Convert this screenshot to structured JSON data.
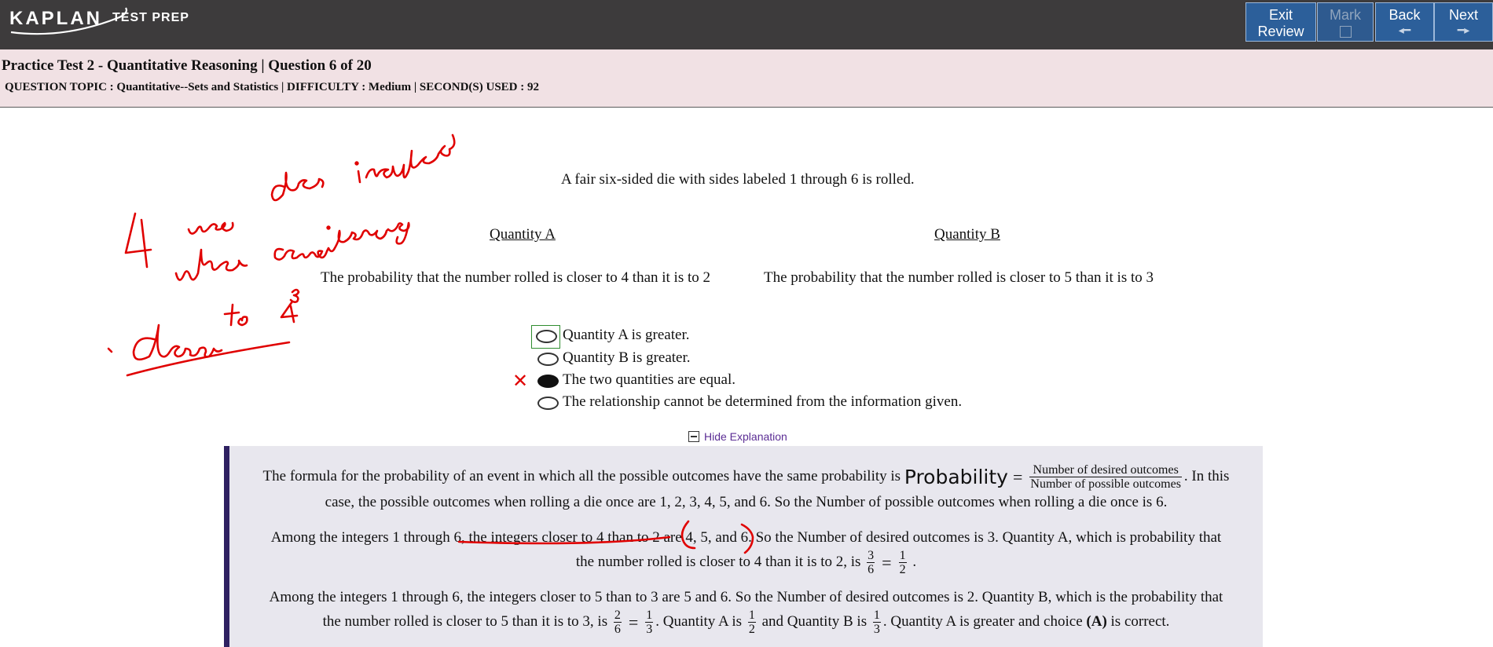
{
  "topbar": {
    "logo_brand": "KAPLAN",
    "logo_sub": "TEST PREP",
    "buttons": {
      "exit_line1": "Exit",
      "exit_line2": "Review",
      "mark": "Mark",
      "back": "Back",
      "back_arrow": "◂━",
      "next": "Next",
      "next_arrow": "━▸"
    }
  },
  "header": {
    "title": "Practice Test 2 - Quantitative Reasoning | Question 6 of 20",
    "meta": "QUESTION TOPIC : Quantitative--Sets and Statistics | DIFFICULTY : Medium | SECOND(S) USED : 92"
  },
  "question": {
    "stem": "A fair six-sided die with sides labeled 1 through 6 is rolled.",
    "quantity_a_label": "Quantity A",
    "quantity_b_label": "Quantity B",
    "quantity_a_text": "The probability that the number rolled is closer to 4 than it is to 2",
    "quantity_b_text": "The probability that the number rolled is closer to 5 than it is to 3",
    "choices": [
      {
        "label": "Quantity A is greater.",
        "selected": false
      },
      {
        "label": "Quantity B is greater.",
        "selected": false
      },
      {
        "label": "The two quantities are equal.",
        "selected": true
      },
      {
        "label": "The relationship cannot be determined from the information given.",
        "selected": false
      }
    ],
    "wrong_mark": "✕",
    "hide_explanation": "Hide Explanation"
  },
  "explanation": {
    "p1_a": "The formula for the probability of an event in which all the possible outcomes have the same probability is",
    "p1_prob": "Probability",
    "p1_eq": "=",
    "p1_num": "Number of desired outcomes",
    "p1_den": "Number of possible outcomes",
    "p1_b": ". In this",
    "p1_c": "case, the possible outcomes when rolling a die once are 1, 2, 3, 4, 5, and 6. So the Number of possible outcomes when rolling a die once is 6.",
    "p2_a": "Among the integers 1 through 6, the integers closer to 4 than to 2 are 4, 5, and 6. So the Number of desired outcomes is 3. Quantity A, which is probability that",
    "p2_b": "the number rolled is closer to 4 than it is to 2, is",
    "p2_f1n": "3",
    "p2_f1d": "6",
    "p2_eq": "=",
    "p2_f2n": "1",
    "p2_f2d": "2",
    "p2_end": ".",
    "p3_a": "Among the integers 1 through 6, the integers closer to 5 than to 3 are 5 and 6. So the Number of desired outcomes is 2. Quantity B, which is the probability that",
    "p3_b": "the number rolled is closer to 5 than it is to 3, is",
    "p3_f1n": "2",
    "p3_f1d": "6",
    "p3_eq": "=",
    "p3_f2n": "1",
    "p3_f2d": "3",
    "p3_c": ". Quantity A is",
    "p3_f3n": "1",
    "p3_f3d": "2",
    "p3_d": "and Quantity B is",
    "p3_f4n": "1",
    "p3_f4d": "3",
    "p3_e": ". Quantity A is greater and choice",
    "p3_choice": "(A)",
    "p3_f": "is correct."
  },
  "colors": {
    "topbar": "#3d3b3c",
    "button": "#2c5f9a",
    "header_band": "#f1e1e4",
    "explanation_bg": "#e8e7ee",
    "explanation_border": "#2f2162",
    "ink": "#e00000",
    "link": "#5b2d94"
  }
}
